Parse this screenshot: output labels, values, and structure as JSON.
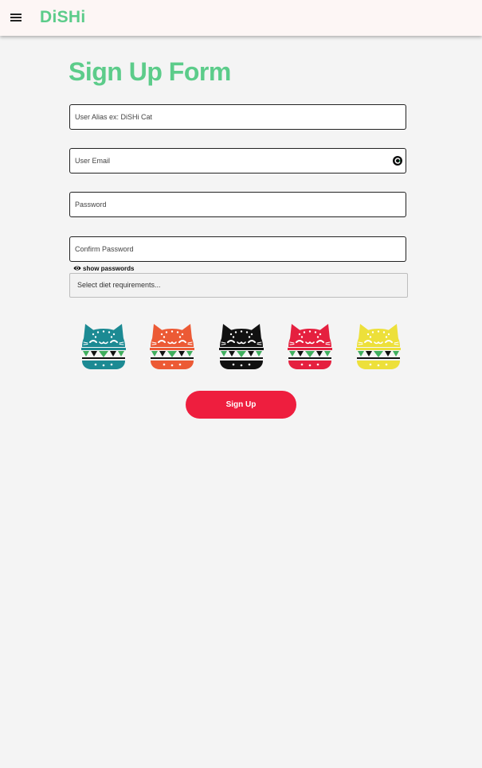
{
  "header": {
    "brand": "DiSHi",
    "menu_icon": "hamburger-menu-icon",
    "background": "#fdf6f5",
    "brand_color": "#5ccc8a"
  },
  "form": {
    "title": "Sign Up Form",
    "alias": {
      "placeholder": "User Alias ex: DiSHi Cat",
      "value": ""
    },
    "email": {
      "placeholder": "User Email",
      "value": "",
      "icon": "autofill-icon"
    },
    "password": {
      "placeholder": "Password",
      "value": ""
    },
    "confirm_password": {
      "placeholder": "Confirm Password",
      "value": ""
    },
    "show_passwords": {
      "label": "show passwords",
      "icon": "eye-icon"
    },
    "diet_select": {
      "placeholder": "Select diet requirements..."
    },
    "avatars": [
      {
        "name": "teal-cat-burger",
        "color": "#1c8a93"
      },
      {
        "name": "orange-cat-burger",
        "color": "#ec5a35"
      },
      {
        "name": "black-cat-burger",
        "color": "#111111"
      },
      {
        "name": "red-cat-burger",
        "color": "#e5203f"
      },
      {
        "name": "yellow-cat-burger",
        "color": "#ede03a"
      }
    ],
    "submit_label": "Sign Up",
    "submit_color": "#ee1e3e"
  }
}
